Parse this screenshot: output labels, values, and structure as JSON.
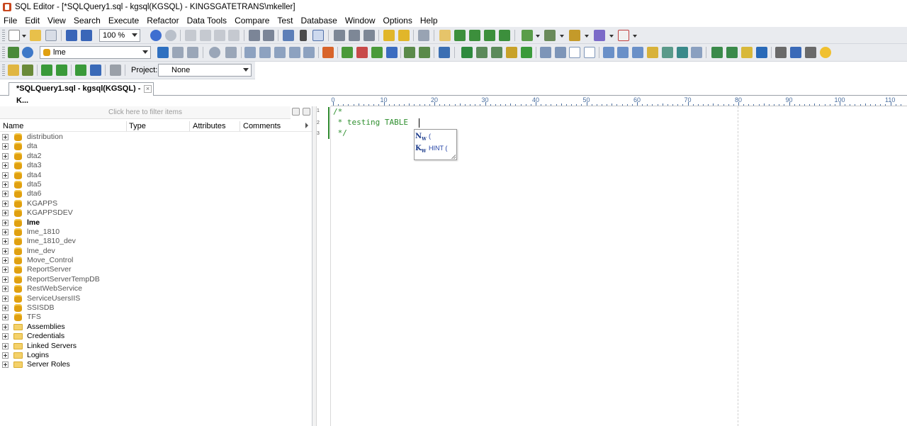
{
  "window": {
    "title": "SQL Editor - [*SQLQuery1.sql - kgsql(KGSQL) - KINGSGATETRANS\\mkeller]"
  },
  "menu": [
    "File",
    "Edit",
    "View",
    "Search",
    "Execute",
    "Refactor",
    "Data Tools",
    "Compare",
    "Test",
    "Database",
    "Window",
    "Options",
    "Help"
  ],
  "toolbar": {
    "zoom": "100 %",
    "database": "lme",
    "project_label": "Project:",
    "project_value": "None"
  },
  "tab": {
    "label": "*SQLQuery1.sql - kgsql(KGSQL) - K...",
    "close": "×"
  },
  "panel": {
    "filter_placeholder": "Click here to filter items",
    "columns": [
      "Name",
      "Type",
      "Attributes",
      "Comments"
    ],
    "databases": [
      "distribution",
      "dta",
      "dta2",
      "dta3",
      "dta4",
      "dta5",
      "dta6",
      "KGAPPS",
      "KGAPPSDEV",
      "lme",
      "lme_1810",
      "lme_1810_dev",
      "lme_dev",
      "Move_Control",
      "ReportServer",
      "ReportServerTempDB",
      "RestWebService",
      "ServiceUsersIIS",
      "SSISDB",
      "TFS"
    ],
    "active_database": "lme",
    "folders": [
      "Assemblies",
      "Credentials",
      "Linked Servers",
      "Logins",
      "Server Roles"
    ]
  },
  "editor": {
    "lines": [
      "/*",
      " * testing TABLE",
      " */"
    ],
    "line_numbers": [
      "1",
      "2",
      "3"
    ],
    "ruler_labels": [
      "0",
      "10",
      "20",
      "30",
      "40",
      "50",
      "60",
      "70",
      "80",
      "90",
      "100",
      "110"
    ],
    "autocomplete": [
      {
        "kw": "N",
        "kw_sub": "W",
        "text": "("
      },
      {
        "kw": "K",
        "kw_sub": "W",
        "text": "HINT ("
      }
    ]
  },
  "colors": {
    "comment": "#2f8f2f",
    "toolbar_bg": "#e9ebef",
    "keyword_blue": "#1f3fa4"
  }
}
